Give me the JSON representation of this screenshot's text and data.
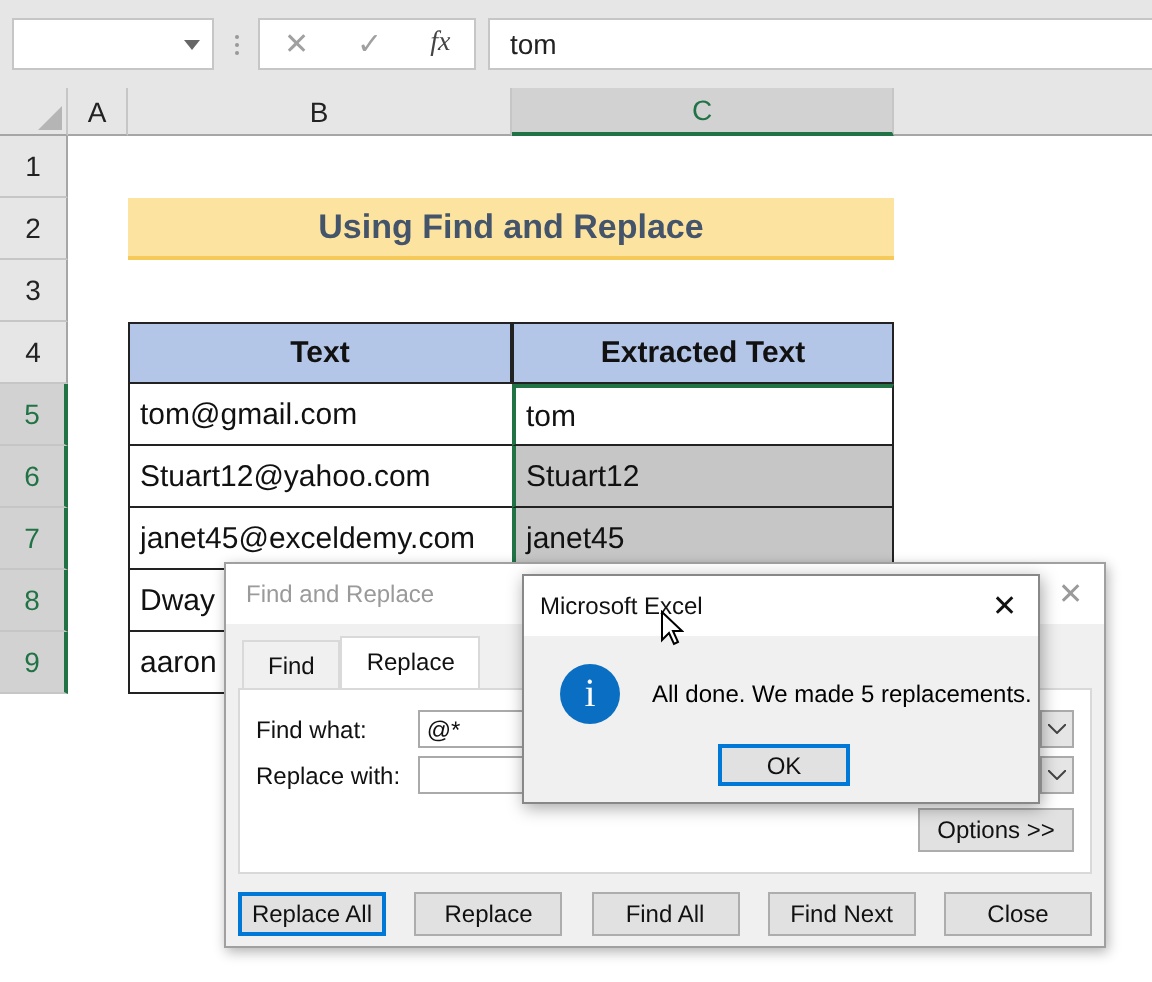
{
  "formula_bar": {
    "cancel_icon": "✕",
    "enter_icon": "✓",
    "function_icon": "fx",
    "value": "tom"
  },
  "columns": [
    {
      "label": "A",
      "selected": false
    },
    {
      "label": "B",
      "selected": false
    },
    {
      "label": "C",
      "selected": true
    }
  ],
  "rows": [
    {
      "label": "1",
      "selected": false
    },
    {
      "label": "2",
      "selected": false
    },
    {
      "label": "3",
      "selected": false
    },
    {
      "label": "4",
      "selected": false
    },
    {
      "label": "5",
      "selected": true
    },
    {
      "label": "6",
      "selected": true
    },
    {
      "label": "7",
      "selected": true
    },
    {
      "label": "8",
      "selected": true
    },
    {
      "label": "9",
      "selected": true
    }
  ],
  "title": "Using Find and Replace",
  "table": {
    "columns": [
      "Text",
      "Extracted Text"
    ],
    "rows": [
      {
        "text": "tom@gmail.com",
        "extracted": "tom",
        "highlighted": false
      },
      {
        "text": "Stuart12@yahoo.com",
        "extracted": "Stuart12",
        "highlighted": true
      },
      {
        "text": "janet45@exceldemy.com",
        "extracted": "janet45",
        "highlighted": true
      },
      {
        "text": "Dway"
      },
      {
        "text": "aaron"
      }
    ]
  },
  "find_replace_dialog": {
    "title": "Find and Replace",
    "close": "✕",
    "tabs": [
      {
        "label": "Find",
        "selected": false
      },
      {
        "label": "Replace",
        "selected": true
      }
    ],
    "fields": [
      {
        "label": "Find what:",
        "value": "@*"
      },
      {
        "label": "Replace with:"
      }
    ],
    "options_button": "Options >>",
    "buttons": [
      {
        "label": "Replace All",
        "default": true
      },
      {
        "label": "Replace",
        "default": false
      },
      {
        "label": "Find All",
        "default": false
      },
      {
        "label": "Find Next",
        "default": false
      },
      {
        "label": "Close",
        "default": false
      }
    ]
  },
  "message_box": {
    "title": "Microsoft Excel",
    "close": "✕",
    "icon_letter": "i",
    "message": "All done. We made 5 replacements.",
    "button": "OK"
  }
}
